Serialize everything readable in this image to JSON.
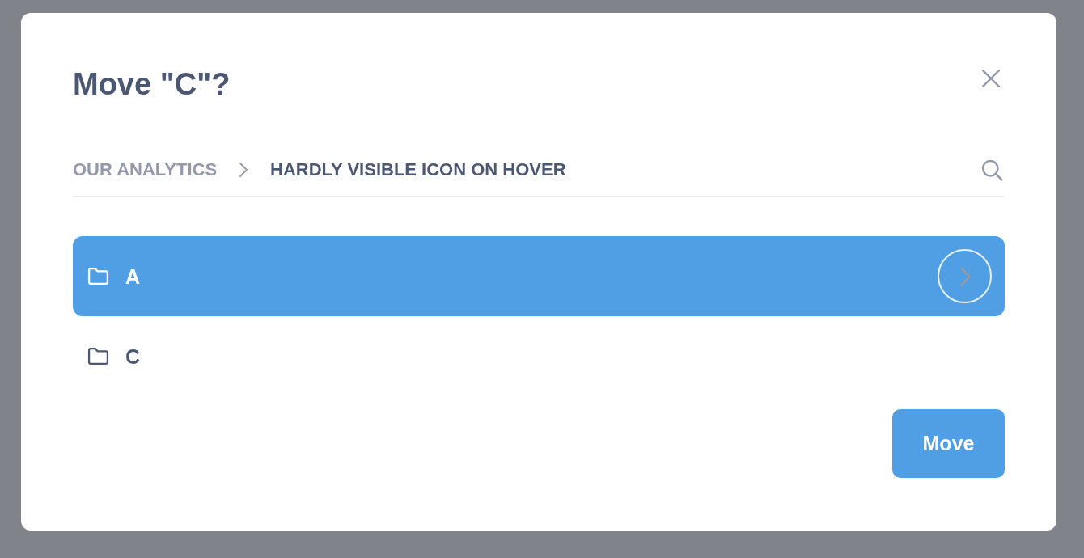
{
  "dialog": {
    "title": "Move \"C\"?"
  },
  "breadcrumb": [
    {
      "label": "OUR ANALYTICS",
      "selected": false
    },
    {
      "label": "HARDLY VISIBLE ICON ON HOVER",
      "selected": true
    }
  ],
  "items": [
    {
      "name": "A",
      "selected": true
    },
    {
      "name": "C",
      "selected": false
    }
  ],
  "buttons": [
    {
      "label": "Move"
    }
  ]
}
